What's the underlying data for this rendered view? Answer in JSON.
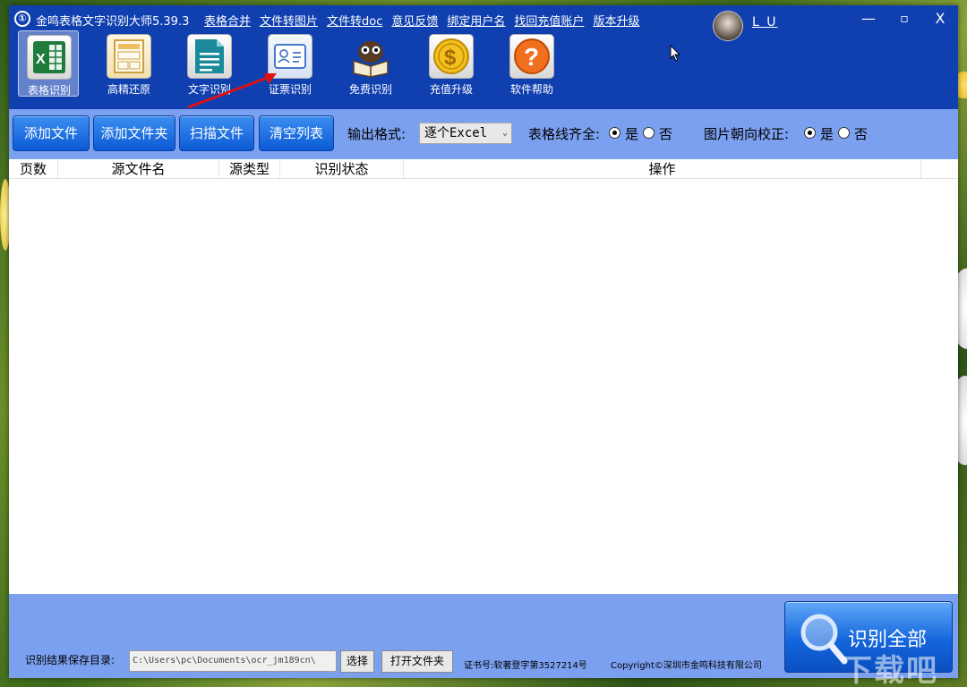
{
  "titlebar": {
    "logo": "①",
    "app_title": "金鸣表格文字识别大师5.39.3",
    "links": [
      "表格合并",
      "文件转图片",
      "文件转doc",
      "意见反馈",
      "绑定用户名",
      "找回充值账户",
      "版本升级"
    ],
    "username": "L U",
    "minimize": "—",
    "maximize": "▫",
    "close": "X"
  },
  "toolbar": {
    "tools": [
      {
        "label": "表格识别",
        "icon": "excel-icon"
      },
      {
        "label": "高精还原",
        "icon": "layout-icon"
      },
      {
        "label": "文字识别",
        "icon": "document-icon"
      },
      {
        "label": "证票识别",
        "icon": "id-card-icon"
      },
      {
        "label": "免费识别",
        "icon": "owl-book-icon"
      },
      {
        "label": "充值升级",
        "icon": "coin-icon"
      },
      {
        "label": "软件帮助",
        "icon": "help-icon"
      }
    ]
  },
  "options": {
    "add_file": "添加文件",
    "add_folder": "添加文件夹",
    "scan_file": "扫描文件",
    "clear_list": "清空列表",
    "output_format_label": "输出格式:",
    "output_format_value": "逐个Excel",
    "table_lines_label": "表格线齐全:",
    "image_orientation_label": "图片朝向校正:",
    "yes": "是",
    "no": "否"
  },
  "table": {
    "columns": [
      "页数",
      "源文件名",
      "源类型",
      "识别状态",
      "操作"
    ]
  },
  "bottom": {
    "save_dir_label": "识别结果保存目录:",
    "save_dir_value": "C:\\Users\\pc\\Documents\\ocr_jm189cn\\",
    "choose": "选择",
    "open_folder": "打开文件夹",
    "cert": "证书号:软著登字第3527214号",
    "copyright": "Copyright©深圳市金鸣科技有限公司",
    "recognize_all": "识别全部"
  },
  "watermark": "下载吧"
}
